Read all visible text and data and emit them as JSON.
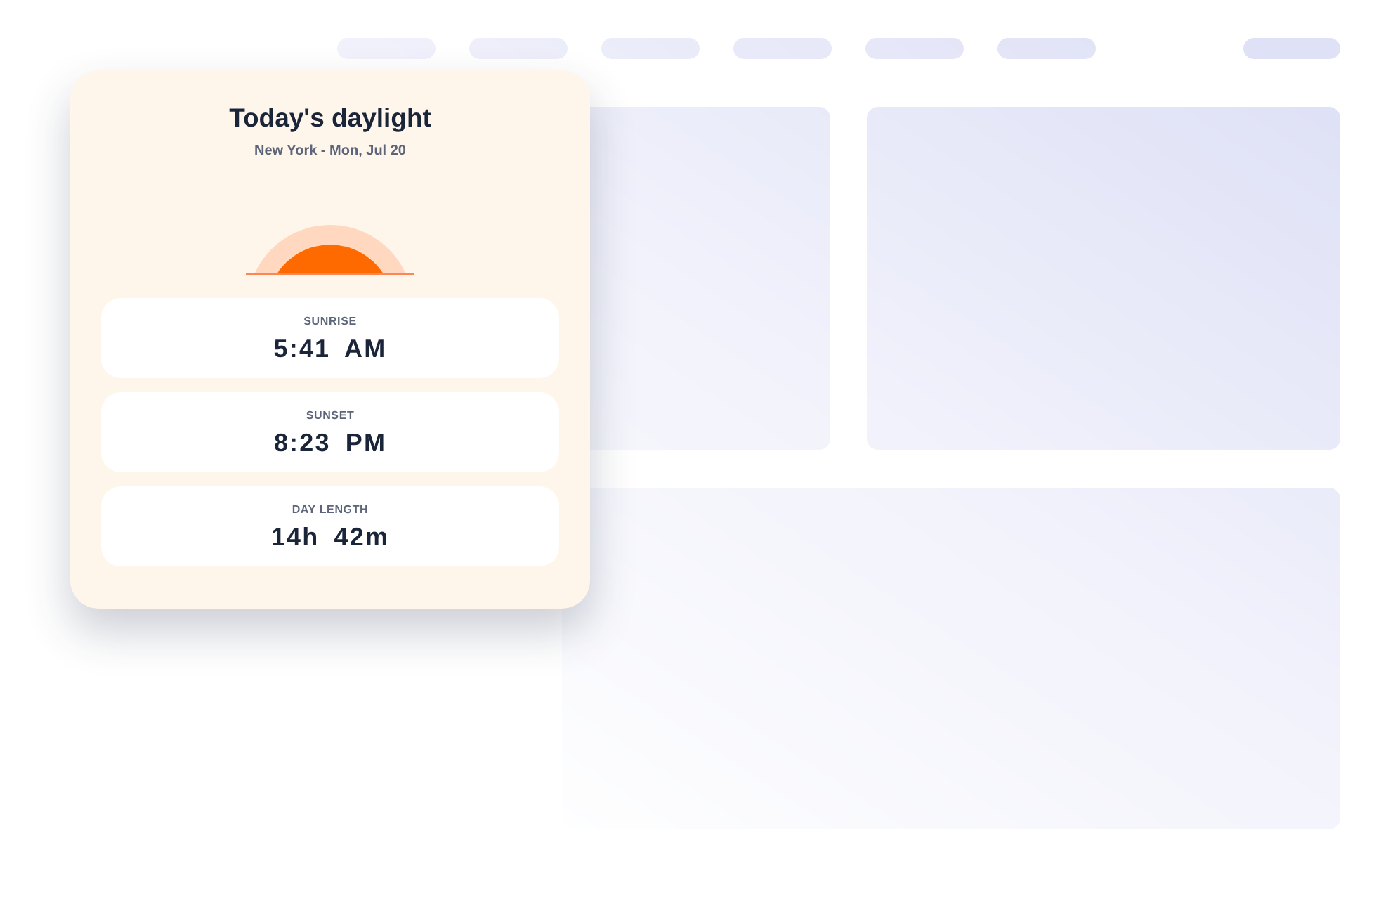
{
  "card": {
    "title": "Today's daylight",
    "subtitle": "New York - Mon, Jul 20"
  },
  "stats": [
    {
      "label": "SUNRISE",
      "value": "5:41 AM"
    },
    {
      "label": "SUNSET",
      "value": "8:23 PM"
    },
    {
      "label": "DAY LENGTH",
      "value": "14h 42m"
    }
  ]
}
